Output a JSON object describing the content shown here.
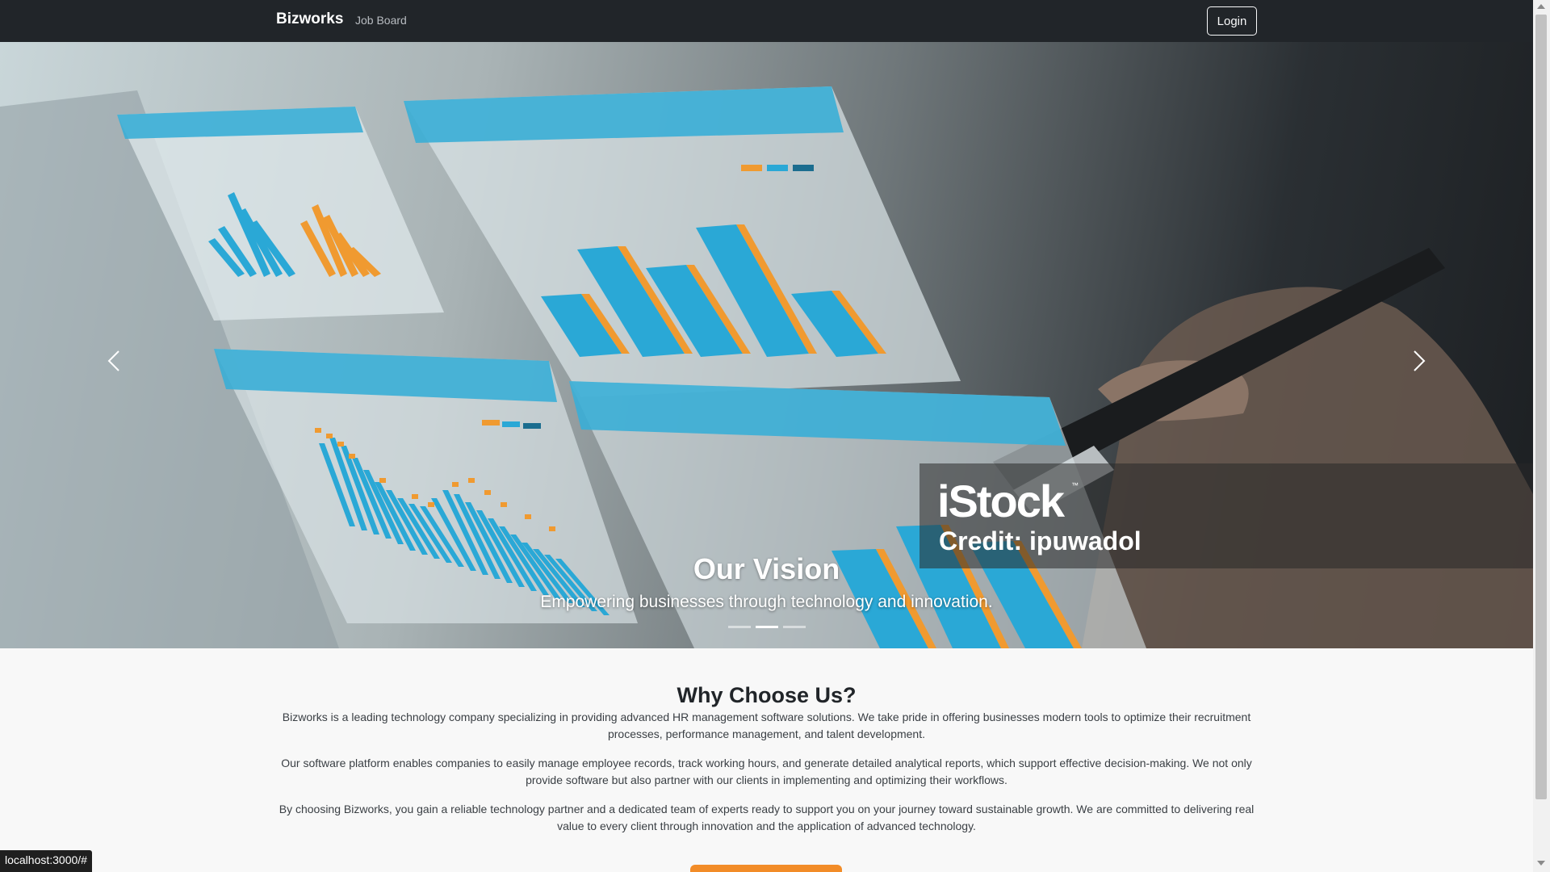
{
  "navbar": {
    "brand": "Bizworks",
    "links": [
      "Job Board"
    ],
    "login_label": "Login"
  },
  "hero": {
    "slides_count": 3,
    "active_slide": 2,
    "caption_title": "Our Vision",
    "caption_subtitle": "Empowering businesses through technology and innovation.",
    "watermark": {
      "logo": "iStock",
      "tm": "™",
      "credit": "Credit: ipuwadol"
    },
    "prev_icon": "chevron-left-icon",
    "next_icon": "chevron-right-icon"
  },
  "why_choose": {
    "title": "Why Choose Us?",
    "paragraphs": [
      "Bizworks is a leading technology company specializing in providing advanced HR management software solutions. We take pride in offering businesses modern tools to optimize their recruitment processes, performance management, and talent development.",
      "Our software platform enables companies to easily manage employee records, track working hours, and generate detailed analytical reports, which support effective decision-making. We not only provide software but also partner with our clients in implementing and optimizing their workflows.",
      "By choosing Bizworks, you gain a reliable technology partner and a dedicated team of experts ready to support you on your journey toward sustainable growth. We are committed to delivering real value to every client through innovation and the application of advanced technology."
    ]
  },
  "status_bar": {
    "url": "localhost:3000/#"
  },
  "colors": {
    "navbar_bg": "#212529",
    "accent_orange": "#f28c28",
    "chart_blue": "#2aa8d6",
    "chart_dark_blue": "#1b6d8f",
    "page_bg": "#f8f8f8"
  }
}
